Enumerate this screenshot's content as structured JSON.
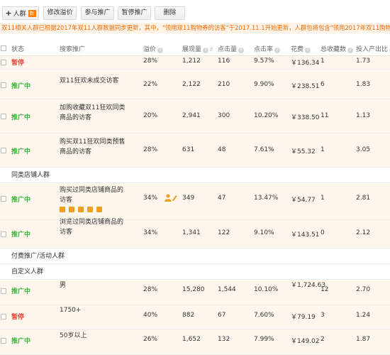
{
  "toolbar": {
    "add_crowd": "人群",
    "new_badge": "新",
    "modify_bid": "修改溢价",
    "join_promo": "参与推广",
    "pause_promo": "暂停推广",
    "delete": "删除"
  },
  "notice": "双11相关人群已根据2017年双11人群数据同步更新，其中，\"领用双11购物券的访客\"于2017.11.1开始更新，人群包将包含\"领用2017年双11购物",
  "columns": {
    "status": "状态",
    "promo": "搜索推广",
    "premium": "溢价",
    "impressions": "展现量",
    "clicks": "点击量",
    "ctr": "点击率",
    "cost": "花费",
    "favorites": "总收藏数",
    "roi": "投入产出比"
  },
  "rows": [
    {
      "status": "暂停",
      "name": "",
      "premium": "28%",
      "impressions": "1,212",
      "clicks": "116",
      "ctr": "9.57%",
      "cost": "￥136.34",
      "fav": "1",
      "roi": "1.73"
    },
    {
      "status": "推广中",
      "name": "双11狂欢未成交访客",
      "premium": "22%",
      "impressions": "2,122",
      "clicks": "210",
      "ctr": "9.90%",
      "cost": "￥238.51",
      "fav": "6",
      "roi": "1.83"
    },
    {
      "status": "推广中",
      "name": "加购收藏双11狂欢同类商品的访客",
      "premium": "20%",
      "impressions": "2,941",
      "clicks": "300",
      "ctr": "10.20%",
      "cost": "￥338.50",
      "fav": "11",
      "roi": "1.13"
    },
    {
      "status": "推广中",
      "name": "购买双11狂欢同类预售商品的访客",
      "premium": "28%",
      "impressions": "631",
      "clicks": "48",
      "ctr": "7.61%",
      "cost": "￥55.32",
      "fav": "1",
      "roi": "3.05"
    },
    {
      "status": "推广中",
      "name": "购买过同类店铺商品的访客",
      "premium": "34%",
      "impressions": "349",
      "clicks": "47",
      "ctr": "13.47%",
      "cost": "￥54.77",
      "fav": "1",
      "roi": "2.81"
    },
    {
      "status": "推广中",
      "name": "浏览过同类店铺商品的访客",
      "premium": "34%",
      "impressions": "1,341",
      "clicks": "122",
      "ctr": "9.10%",
      "cost": "￥143.51",
      "fav": "0",
      "roi": "2.12"
    },
    {
      "status": "推广中",
      "name": "男",
      "premium": "28%",
      "impressions": "15,280",
      "clicks": "1,544",
      "ctr": "10.10%",
      "cost": "￥1,724.63",
      "fav": "12",
      "roi": "2.70"
    },
    {
      "status": "暂停",
      "name": "1750+",
      "premium": "40%",
      "impressions": "882",
      "clicks": "67",
      "ctr": "7.60%",
      "cost": "￥79.19",
      "fav": "3",
      "roi": "1.24"
    },
    {
      "status": "推广中",
      "name": "50岁以上",
      "premium": "26%",
      "impressions": "1,652",
      "clicks": "132",
      "ctr": "7.99%",
      "cost": "￥149.02",
      "fav": "2",
      "roi": "1.87"
    }
  ],
  "groups": {
    "same_shop": "同类店铺人群",
    "paid_activity": "付费推广/活动人群",
    "custom": "自定义人群"
  }
}
